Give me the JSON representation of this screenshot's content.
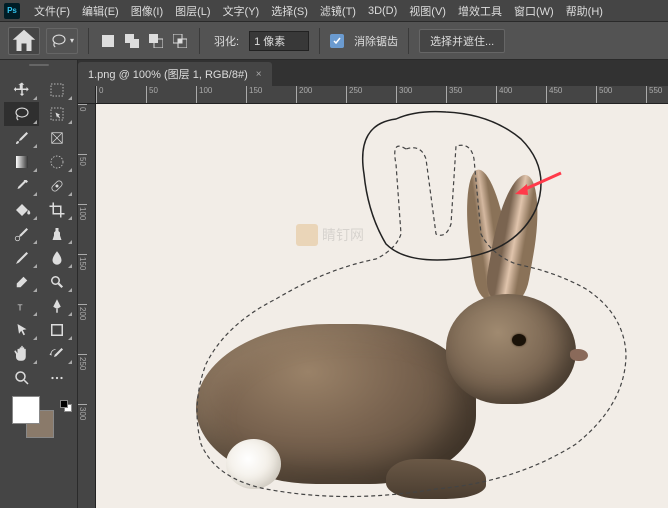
{
  "menu": {
    "items": [
      "文件(F)",
      "编辑(E)",
      "图像(I)",
      "图层(L)",
      "文字(Y)",
      "选择(S)",
      "滤镜(T)",
      "3D(D)",
      "视图(V)",
      "增效工具",
      "窗口(W)",
      "帮助(H)"
    ]
  },
  "options": {
    "feather_label": "羽化:",
    "feather_value": "1 像素",
    "antialias_label": "消除锯齿",
    "select_mask_label": "选择并遮住..."
  },
  "tab": {
    "title": "1.png @ 100% (图层 1, RGB/8#)"
  },
  "ruler_h": [
    "0",
    "50",
    "100",
    "150",
    "200",
    "250",
    "300",
    "350",
    "400",
    "450",
    "500",
    "550"
  ],
  "ruler_v": [
    "0",
    "50",
    "100",
    "150",
    "200",
    "250",
    "300"
  ],
  "watermark": {
    "text": "睛钉网"
  },
  "swatches": {
    "fg": "#ffffff",
    "bg": "#8a7a6a"
  }
}
